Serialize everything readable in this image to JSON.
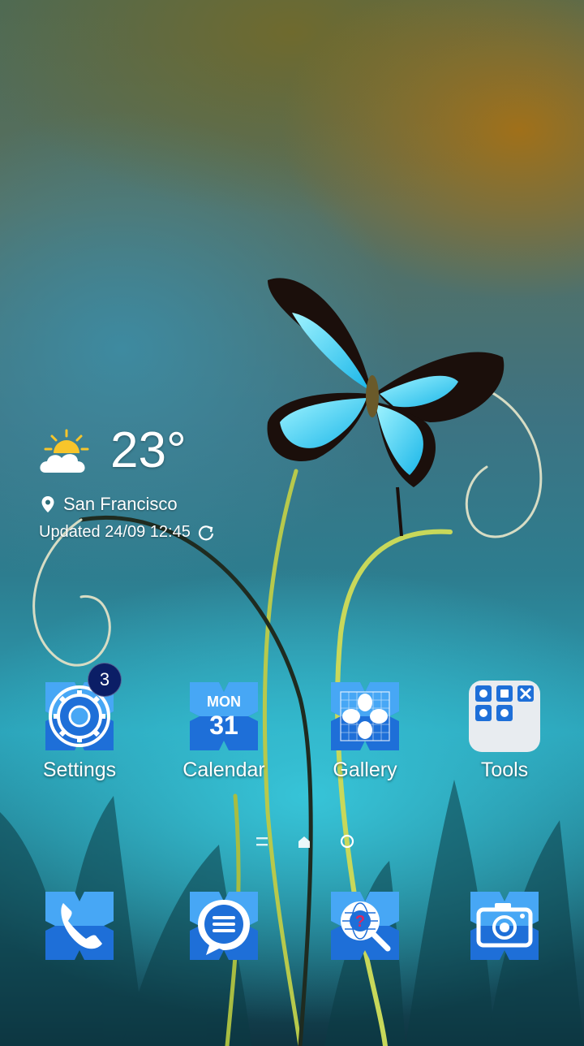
{
  "weather": {
    "icon": "partly-cloudy-icon",
    "temperature": "23°",
    "location": "San Francisco",
    "updated": "Updated 24/09 12:45"
  },
  "apps": [
    {
      "label": "Settings",
      "icon": "settings-gear-icon",
      "badge": "3"
    },
    {
      "label": "Calendar",
      "icon": "calendar-icon",
      "day": "MON",
      "date": "31"
    },
    {
      "label": "Gallery",
      "icon": "gallery-icon"
    },
    {
      "label": "Tools",
      "icon": "tools-folder-icon"
    }
  ],
  "page_indicator": {
    "pages": 3,
    "current": 2
  },
  "dock": [
    {
      "icon": "phone-icon"
    },
    {
      "icon": "messages-icon"
    },
    {
      "icon": "browser-icon"
    },
    {
      "icon": "camera-icon"
    }
  ],
  "colors": {
    "icon_blue": "#1e6fd8",
    "badge": "#0b1e66"
  }
}
